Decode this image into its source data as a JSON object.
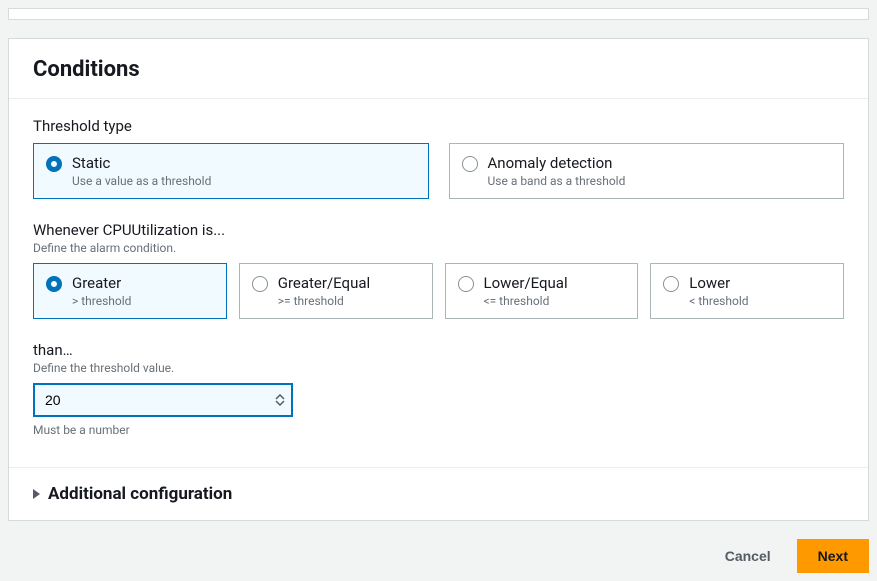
{
  "conditions": {
    "title": "Conditions",
    "thresholdType": {
      "label": "Threshold type",
      "options": {
        "static": {
          "title": "Static",
          "desc": "Use a value as a threshold"
        },
        "anomaly": {
          "title": "Anomaly detection",
          "desc": "Use a band as a threshold"
        }
      }
    },
    "whenever": {
      "label": "Whenever CPUUtilization is...",
      "sub": "Define the alarm condition.",
      "options": {
        "gt": {
          "title": "Greater",
          "desc": "> threshold"
        },
        "gte": {
          "title": "Greater/Equal",
          "desc": ">= threshold"
        },
        "lte": {
          "title": "Lower/Equal",
          "desc": "<= threshold"
        },
        "lt": {
          "title": "Lower",
          "desc": "< threshold"
        }
      }
    },
    "than": {
      "label": "than…",
      "sub": "Define the threshold value.",
      "value": "20",
      "hint": "Must be a number"
    },
    "additional": "Additional configuration"
  },
  "buttons": {
    "cancel": "Cancel",
    "next": "Next"
  }
}
